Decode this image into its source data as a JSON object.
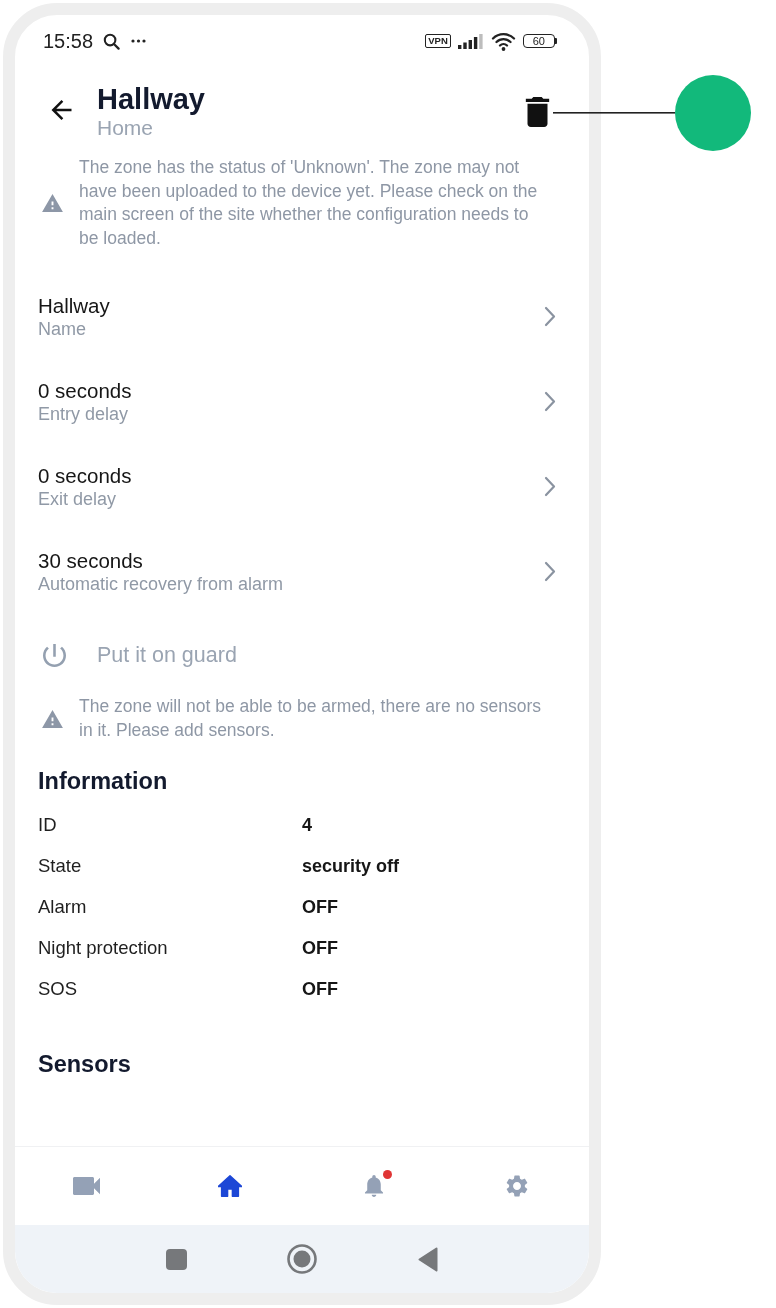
{
  "status_bar": {
    "time": "15:58",
    "vpn": "VPN",
    "battery": "60"
  },
  "header": {
    "title": "Hallway",
    "subtitle": "Home"
  },
  "status_notice": {
    "text": "The zone has the status of 'Unknown'. The zone may not have been uploaded to the device yet. Please check on the main screen of the site whether the configuration needs to be loaded."
  },
  "settings": [
    {
      "value": "Hallway",
      "label": "Name"
    },
    {
      "value": "0 seconds",
      "label": "Entry delay"
    },
    {
      "value": "0 seconds",
      "label": "Exit delay"
    },
    {
      "value": "30 seconds",
      "label": "Automatic recovery from alarm"
    }
  ],
  "guard_action": {
    "label": "Put it on guard",
    "disabled": true
  },
  "guard_notice": {
    "text": "The zone will not be able to be armed, there are no sensors in it. Please add sensors."
  },
  "information": {
    "title": "Information",
    "rows": [
      {
        "label": "ID",
        "value": "4"
      },
      {
        "label": "State",
        "value": "security off"
      },
      {
        "label": "Alarm",
        "value": "OFF"
      },
      {
        "label": "Night protection",
        "value": "OFF"
      },
      {
        "label": "SOS",
        "value": "OFF"
      }
    ]
  },
  "sensors": {
    "title": "Sensors"
  },
  "bottom_nav": [
    {
      "kind": "camera",
      "selected": false,
      "badge": false
    },
    {
      "kind": "home",
      "selected": true,
      "badge": false
    },
    {
      "kind": "bell",
      "selected": false,
      "badge": true
    },
    {
      "kind": "settings",
      "selected": false,
      "badge": false
    }
  ]
}
